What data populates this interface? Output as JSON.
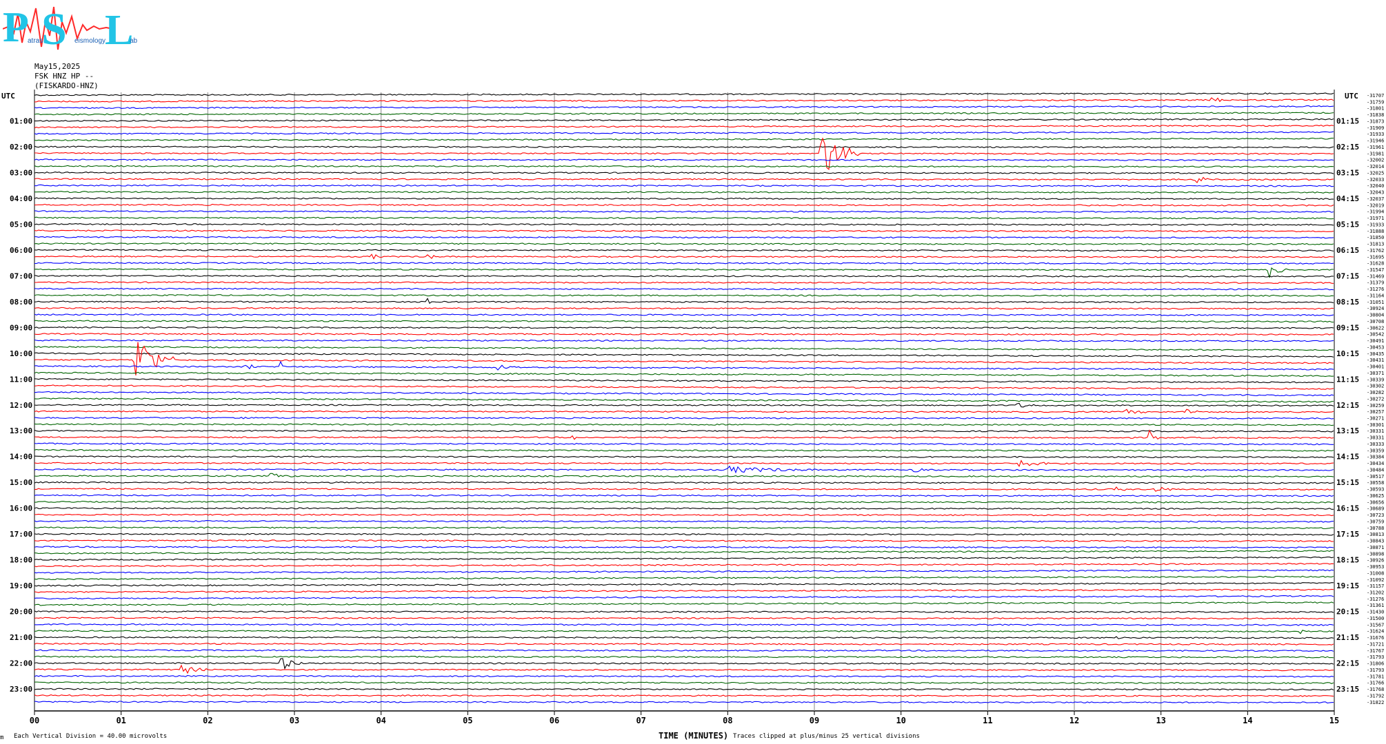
{
  "logo": {
    "letters": [
      "P",
      "S",
      "L"
    ],
    "small_text": [
      "atras",
      "eismology",
      "ab"
    ],
    "colors": {
      "letters": "#22c4e6",
      "wave": "#ff2a2a"
    }
  },
  "header": {
    "date": "May15,2025",
    "station": "FSK HNZ HP --",
    "name": "(FISKARDO-HNZ)"
  },
  "footer": {
    "left_mark": "m",
    "vertical_division": "Each Vertical Division =    40.00 microvolts",
    "xlabel": "TIME (MINUTES)",
    "clip_note": "Traces clipped at plus/minus 25 vertical divisions"
  },
  "chart_data": {
    "type": "line",
    "title": "",
    "xlabel": "TIME (MINUTES)",
    "ylabel": "",
    "xlim": [
      0,
      15
    ],
    "x_ticks": [
      "00",
      "01",
      "02",
      "03",
      "04",
      "05",
      "06",
      "07",
      "08",
      "09",
      "10",
      "11",
      "12",
      "13",
      "14",
      "15"
    ],
    "left_header": "UTC",
    "right_header": "UTC",
    "left_hour_labels": [
      "01:00",
      "02:00",
      "03:00",
      "04:00",
      "05:00",
      "06:00",
      "07:00",
      "08:00",
      "09:00",
      "10:00",
      "11:00",
      "12:00",
      "13:00",
      "14:00",
      "15:00",
      "16:00",
      "17:00",
      "18:00",
      "19:00",
      "20:00",
      "21:00",
      "22:00",
      "23:00"
    ],
    "right_hour_labels": [
      "01:15",
      "02:15",
      "03:15",
      "04:15",
      "05:15",
      "06:15",
      "07:15",
      "08:15",
      "09:15",
      "10:15",
      "11:15",
      "12:15",
      "13:15",
      "14:15",
      "15:15",
      "16:15",
      "17:15",
      "18:15",
      "19:15",
      "20:15",
      "21:15",
      "22:15",
      "23:15"
    ],
    "trace_color_cycle": [
      "#000000",
      "#ff0000",
      "#0000ff",
      "#006400"
    ],
    "trace_offsets": [
      "-31707",
      "-31759",
      "-31801",
      "-31838",
      "-31873",
      "-31909",
      "-31933",
      "-31946",
      "-31961",
      "-31981",
      "-32002",
      "-32014",
      "-32025",
      "-32033",
      "-32040",
      "-32043",
      "-32037",
      "-32019",
      "-31994",
      "-31971",
      "-31933",
      "-31888",
      "-31850",
      "-31813",
      "-31762",
      "-31695",
      "-31628",
      "-31547",
      "-31469",
      "-31379",
      "-31276",
      "-31164",
      "-31051",
      "-30924",
      "-30804",
      "-30708",
      "-30622",
      "-30542",
      "-30491",
      "-30453",
      "-30435",
      "-30431",
      "-30401",
      "-30371",
      "-30339",
      "-30302",
      "-30282",
      "-30272",
      "-30259",
      "-30257",
      "-30271",
      "-30301",
      "-30331",
      "-30331",
      "-30333",
      "-30359",
      "-30384",
      "-30434",
      "-30484",
      "-30517",
      "-30558",
      "-30593",
      "-30625",
      "-30656",
      "-30689",
      "-30723",
      "-30759",
      "-30788",
      "-30813",
      "-30843",
      "-30871",
      "-30898",
      "-30926",
      "-30953",
      "-31008",
      "-31092",
      "-31157",
      "-31202",
      "-31276",
      "-31361",
      "-31430",
      "-31500",
      "-31567",
      "-31624",
      "-31676",
      "-31721",
      "-31767",
      "-31793",
      "-31806",
      "-31793",
      "-31781",
      "-31766",
      "-31768",
      "-31792",
      "-31822"
    ],
    "events": [
      {
        "row": 1,
        "minute": 13.6,
        "amp": 6,
        "dur": 0.12
      },
      {
        "row": 9,
        "minute": 9.07,
        "amp": 40,
        "dur": 0.45
      },
      {
        "row": 13,
        "minute": 13.4,
        "amp": 8,
        "dur": 0.15
      },
      {
        "row": 25,
        "minute": 3.9,
        "amp": 4,
        "dur": 0.1
      },
      {
        "row": 25,
        "minute": 4.55,
        "amp": 5,
        "dur": 0.08
      },
      {
        "row": 27,
        "minute": 14.25,
        "amp": 12,
        "dur": 0.2
      },
      {
        "row": 32,
        "minute": 4.55,
        "amp": 4,
        "dur": 0.08
      },
      {
        "row": 41,
        "minute": 1.15,
        "amp": 45,
        "dur": 0.45
      },
      {
        "row": 42,
        "minute": 2.85,
        "amp": 12,
        "dur": 0.08
      },
      {
        "row": 42,
        "minute": 5.35,
        "amp": 4,
        "dur": 0.25
      },
      {
        "row": 42,
        "minute": 2.45,
        "amp": 4,
        "dur": 0.15
      },
      {
        "row": 49,
        "minute": 13.3,
        "amp": 5,
        "dur": 0.2
      },
      {
        "row": 49,
        "minute": 12.6,
        "amp": 3,
        "dur": 0.3
      },
      {
        "row": 48,
        "minute": 11.35,
        "amp": 3,
        "dur": 0.3
      },
      {
        "row": 50,
        "minute": 2.35,
        "amp": 8,
        "dur": 0.12
      },
      {
        "row": 53,
        "minute": 6.2,
        "amp": 5,
        "dur": 0.12
      },
      {
        "row": 53,
        "minute": 12.88,
        "amp": 10,
        "dur": 0.1
      },
      {
        "row": 57,
        "minute": 11.3,
        "amp": 7,
        "dur": 0.4
      },
      {
        "row": 58,
        "minute": 8.0,
        "amp": 5,
        "dur": 1.0
      },
      {
        "row": 58,
        "minute": 10.15,
        "amp": 6,
        "dur": 0.1
      },
      {
        "row": 59,
        "minute": 2.7,
        "amp": 4,
        "dur": 0.3
      },
      {
        "row": 61,
        "minute": 12.92,
        "amp": 5,
        "dur": 0.25
      },
      {
        "row": 61,
        "minute": 12.5,
        "amp": 4,
        "dur": 0.1
      },
      {
        "row": 83,
        "minute": 14.6,
        "amp": 3,
        "dur": 0.1
      },
      {
        "row": 84,
        "minute": 12.5,
        "amp": 3,
        "dur": 0.1
      },
      {
        "row": 88,
        "minute": 2.85,
        "amp": 10,
        "dur": 0.25
      },
      {
        "row": 89,
        "minute": 1.7,
        "amp": 7,
        "dur": 0.3
      }
    ]
  }
}
